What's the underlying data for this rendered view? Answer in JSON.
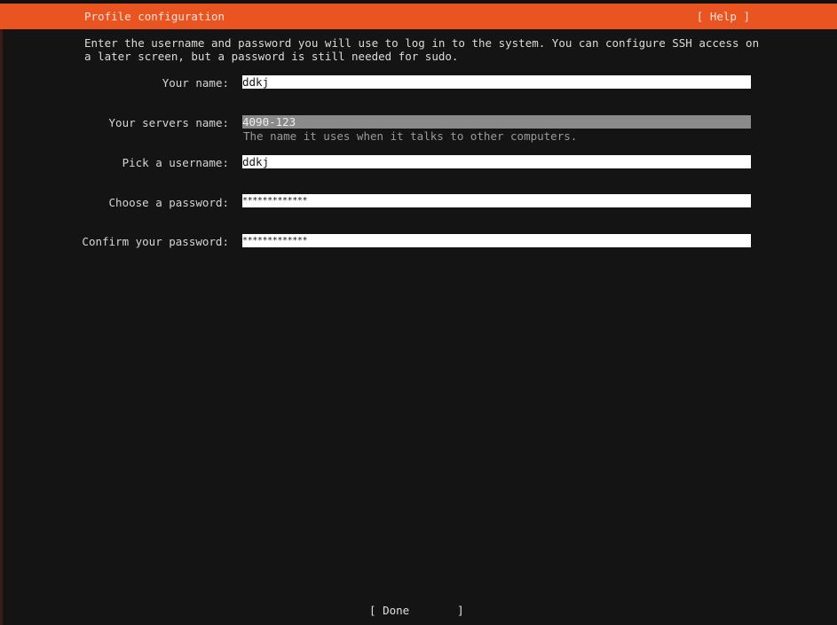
{
  "header": {
    "title": "Profile configuration",
    "help": "[ Help ]"
  },
  "intro": {
    "line1": "Enter the username and password you will use to log in to the system. You can configure SSH access on",
    "line2": "a later screen, but a password is still needed for sudo."
  },
  "fields": {
    "your_name": {
      "label": "Your name:",
      "value": "ddkj"
    },
    "servers_name": {
      "label": "Your servers name:",
      "value": "4090-123",
      "help": "The name it uses when it talks to other computers."
    },
    "username": {
      "label": "Pick a username:",
      "value": "ddkj"
    },
    "password": {
      "label": "Choose a password:",
      "value": "*************"
    },
    "confirm_password": {
      "label": "Confirm your password:",
      "value": "*************"
    }
  },
  "footer": {
    "open": "[ ",
    "done": "Done",
    "close": "]"
  },
  "colors": {
    "header_bg": "#e95420",
    "background": "#141414",
    "input_bg": "#ffffff",
    "focused_input_bg": "#8a8a8a"
  }
}
